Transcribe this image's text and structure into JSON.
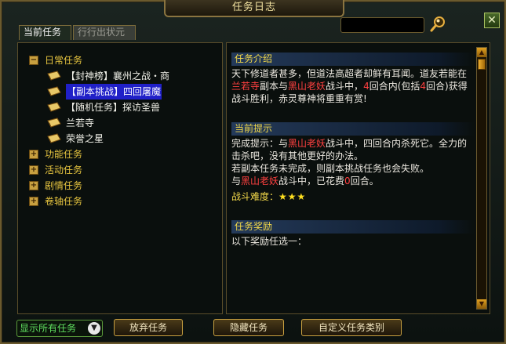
{
  "window": {
    "title": "任务日志",
    "close_label": "✕"
  },
  "search": {
    "value": "",
    "icon": "magnifier-icon"
  },
  "tabs": [
    {
      "label": "当前任务",
      "active": true
    },
    {
      "label": "行行出状元",
      "active": false
    }
  ],
  "tree": {
    "daily": {
      "label": "日常任务",
      "toggle": "−",
      "quests": [
        {
          "label": "【封神榜】襄州之战・商"
        },
        {
          "label": "【副本挑战】四回屠魔",
          "selected": true
        },
        {
          "label": "【随机任务】探访圣兽"
        },
        {
          "label": "兰若寺"
        },
        {
          "label": "荣誉之星"
        }
      ]
    },
    "categories": [
      {
        "label": "功能任务",
        "toggle": "+"
      },
      {
        "label": "活动任务",
        "toggle": "+"
      },
      {
        "label": "剧情任务",
        "toggle": "+"
      },
      {
        "label": "卷轴任务",
        "toggle": "+"
      }
    ]
  },
  "intro": {
    "header": "任务介绍",
    "t1": "天下修道者甚多，但道法高超者却鲜有耳闻。道友若能在",
    "place": "兰若寺",
    "t2": "副本与",
    "boss": "黑山老妖",
    "t3": "战斗中，",
    "n1": "4",
    "t4": "回合内(包括",
    "n2": "4",
    "t5": "回合)获得战斗胜利，赤灵尊神将重重有赏!"
  },
  "tips": {
    "header": "当前提示",
    "l1a": "完成提示：与",
    "l1boss": "黑山老妖",
    "l1b": "战斗中，四回合内杀死它。全力的击杀吧，没有其他更好的办法。",
    "l2": "若副本任务未完成，则副本挑战任务也会失败。",
    "l3a": "与",
    "l3boss": "黑山老妖",
    "l3b": "战斗中，已花费",
    "l3n": "0",
    "l3c": "回合。",
    "difficulty_label": "战斗难度：",
    "stars": "★★★"
  },
  "reward": {
    "header": "任务奖励",
    "text": "以下奖励任选一："
  },
  "footer": {
    "filter": "显示所有任务",
    "abandon": "放弃任务",
    "hide": "隐藏任务",
    "custom": "自定义任务类别"
  },
  "colors": {
    "accent": "#f2d84a",
    "highlight": "#ff4040",
    "selection": "#2020c8"
  }
}
